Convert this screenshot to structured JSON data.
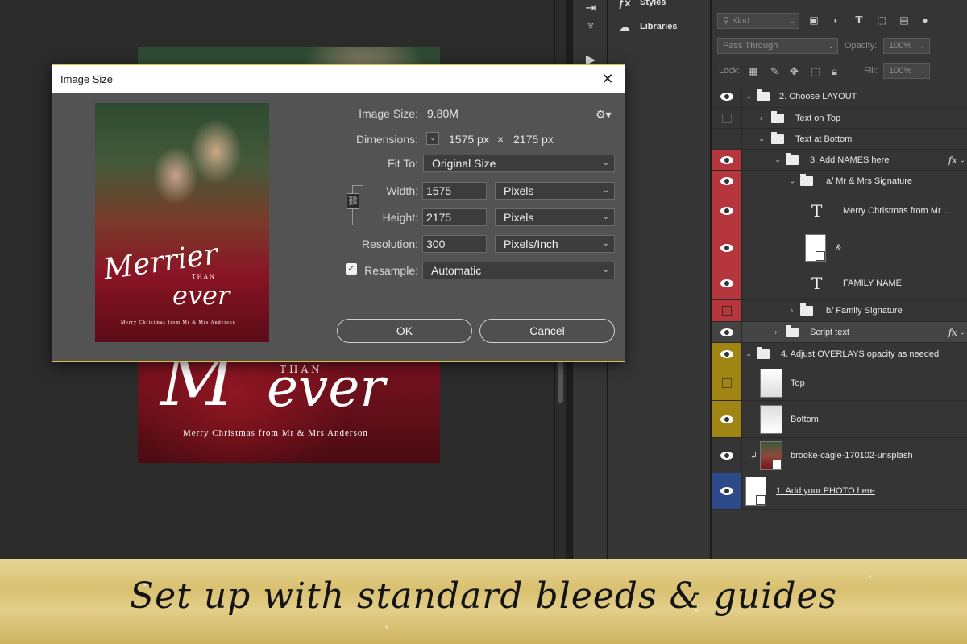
{
  "canvas": {
    "doc_m": "M",
    "doc_than": "THAN",
    "doc_ever": "ever",
    "doc_merry": "Merry Christmas from Mr & Mrs Anderson"
  },
  "side_panel": {
    "styles_label": "Styles",
    "libraries_label": "Libraries"
  },
  "layers_panel": {
    "filter_kind": "Kind",
    "blend_mode": "Pass Through",
    "opacity_label": "Opacity:",
    "opacity_value": "100%",
    "lock_label": "Lock:",
    "fill_label": "Fill:",
    "fill_value": "100%",
    "layers": [
      {
        "name": "2. Choose LAYOUT"
      },
      {
        "name": "Text on Top"
      },
      {
        "name": "Text at Bottom"
      },
      {
        "name": "3. Add NAMES here",
        "fx": "fx"
      },
      {
        "name": "a/ Mr & Mrs Signature"
      },
      {
        "name": "Merry Christmas from Mr ..."
      },
      {
        "name": "&"
      },
      {
        "name": "FAMILY NAME"
      },
      {
        "name": "b/ Family Signature"
      },
      {
        "name": "Script text",
        "fx": "fx"
      },
      {
        "name": "4. Adjust OVERLAYS opacity as needed"
      },
      {
        "name": "Top"
      },
      {
        "name": "Bottom"
      },
      {
        "name": "brooke-cagle-170102-unsplash"
      },
      {
        "name": "1. Add your PHOTO here "
      }
    ]
  },
  "dialog": {
    "title": "Image Size",
    "image_size_label": "Image Size:",
    "image_size_value": "9.80M",
    "dimensions_label": "Dimensions:",
    "dim_width": "1575 px",
    "dim_times": "×",
    "dim_height": "2175 px",
    "fit_to_label": "Fit To:",
    "fit_to_value": "Original Size",
    "width_label": "Width:",
    "width_value": "1575",
    "width_unit": "Pixels",
    "height_label": "Height:",
    "height_value": "2175",
    "height_unit": "Pixels",
    "resolution_label": "Resolution:",
    "resolution_value": "300",
    "resolution_unit": "Pixels/Inch",
    "resample_label": "Resample:",
    "resample_checked": true,
    "resample_value": "Automatic",
    "ok_label": "OK",
    "cancel_label": "Cancel",
    "preview": {
      "merrier": "Merrier",
      "than": "THAN",
      "ever": "ever",
      "merry": "Merry Christmas from Mr & Mrs Anderson"
    }
  },
  "banner": {
    "text": "Set up with standard bleeds & guides"
  },
  "colors": {
    "red_layer": "#b6363d",
    "gold_layer": "#a08414",
    "blue_layer": "#2c4a8a",
    "dialog_border": "#d8c048"
  }
}
